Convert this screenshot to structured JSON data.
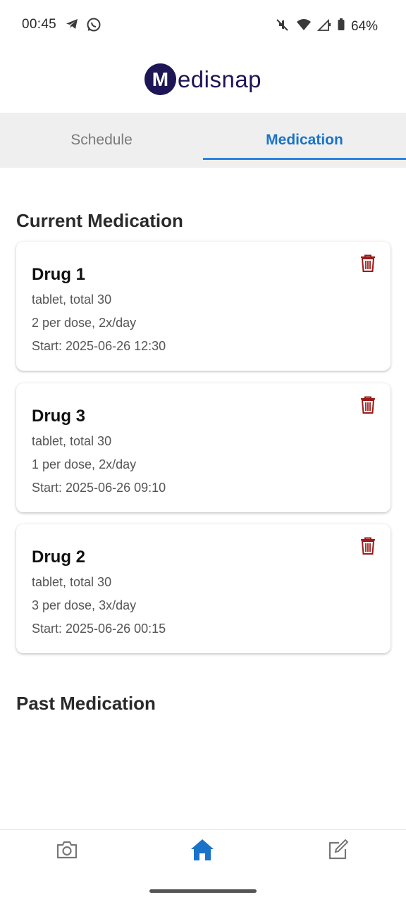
{
  "status_bar": {
    "time": "00:45",
    "battery_percent": "64%",
    "icons": [
      "telegram-icon",
      "whatsapp-icon",
      "mute-icon",
      "wifi-icon",
      "signal-icon",
      "battery-icon"
    ]
  },
  "app": {
    "logo_letter": "M",
    "logo_text": "edisnap",
    "brand_color": "#1e1556",
    "accent_color": "#1a73c8"
  },
  "tabs": [
    {
      "label": "Schedule",
      "active": false
    },
    {
      "label": "Medication",
      "active": true
    }
  ],
  "sections": {
    "current_title": "Current Medication",
    "past_title": "Past Medication"
  },
  "medications": [
    {
      "name": "Drug 1",
      "form": "tablet, total 30",
      "dosage": "2 per dose, 2x/day",
      "start": "Start: 2025-06-26 12:30"
    },
    {
      "name": "Drug 3",
      "form": "tablet, total 30",
      "dosage": "1 per dose, 2x/day",
      "start": "Start: 2025-06-26 09:10"
    },
    {
      "name": "Drug 2",
      "form": "tablet, total 30",
      "dosage": "3 per dose, 3x/day",
      "start": "Start: 2025-06-26 00:15"
    }
  ],
  "bottom_nav": [
    {
      "icon": "camera-icon",
      "active": false
    },
    {
      "icon": "home-icon",
      "active": true
    },
    {
      "icon": "edit-icon",
      "active": false
    }
  ],
  "delete_icon_color": "#9b1b1b"
}
